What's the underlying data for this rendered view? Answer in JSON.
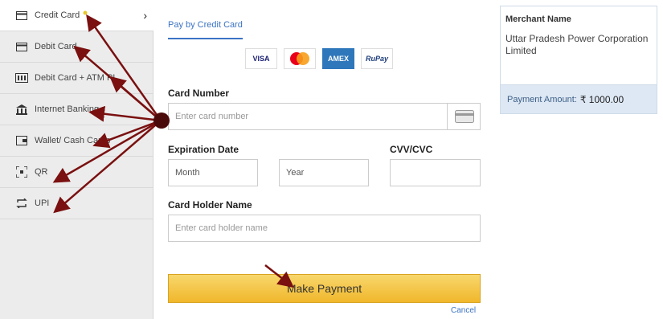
{
  "sidebar": {
    "items": [
      {
        "label": "Credit Card",
        "icon": "credit-card-icon"
      },
      {
        "label": "Debit Card",
        "icon": "debit-card-icon"
      },
      {
        "label": "Debit Card + ATM PI",
        "icon": "atm-pin-icon"
      },
      {
        "label": "Internet Banking",
        "icon": "bank-icon"
      },
      {
        "label": "Wallet/ Cash Cards",
        "icon": "wallet-icon"
      },
      {
        "label": "QR",
        "icon": "qr-icon"
      },
      {
        "label": "UPI",
        "icon": "upi-icon"
      }
    ]
  },
  "form": {
    "tab_label": "Pay by Credit Card",
    "card_logos": [
      "VISA",
      "",
      "AMEX",
      "RuPay"
    ],
    "card_number_label": "Card Number",
    "card_number_placeholder": "Enter card number",
    "expiration_label": "Expiration Date",
    "month_placeholder": "Month",
    "year_placeholder": "Year",
    "cvv_label": "CVV/CVC",
    "holder_label": "Card Holder Name",
    "holder_placeholder": "Enter card holder name",
    "pay_button": "Make Payment",
    "cancel": "Cancel"
  },
  "merchant": {
    "title": "Merchant Name",
    "name": "Uttar Pradesh Power Corporation Limited",
    "amount_label": "Payment Amount:",
    "amount_value": "₹ 1000.00"
  },
  "colors": {
    "accent": "#3b73c4",
    "button": "#f0b72b",
    "annotation": "#7a1010"
  }
}
